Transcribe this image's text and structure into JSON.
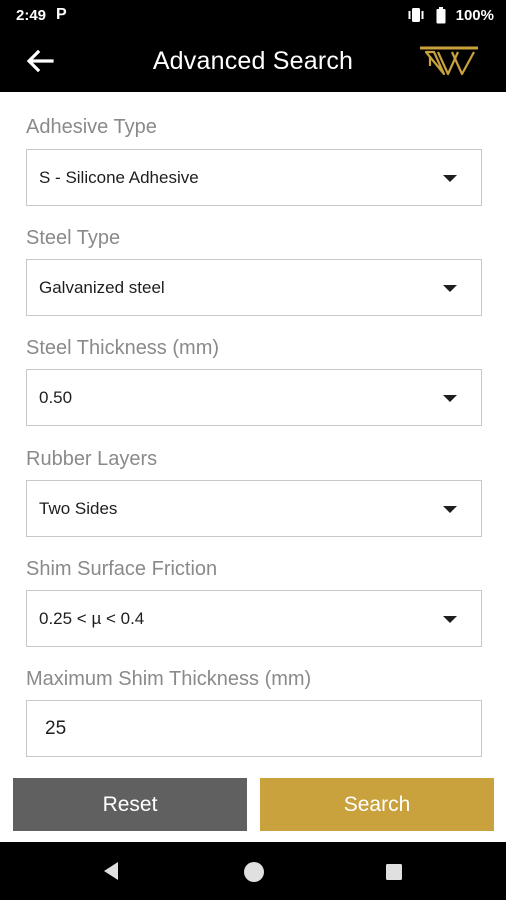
{
  "status_bar": {
    "time": "2:49",
    "notification_icon": "P",
    "battery": "100%",
    "icons": [
      "vibrate-icon",
      "battery-icon"
    ]
  },
  "app_bar": {
    "title": "Advanced Search",
    "back_icon": "arrow-left-icon",
    "logo": "brand-logo"
  },
  "form": {
    "adhesive_type": {
      "label": "Adhesive Type",
      "value": "S - Silicone Adhesive"
    },
    "steel_type": {
      "label": "Steel Type",
      "value": "Galvanized steel"
    },
    "steel_thickness": {
      "label": "Steel Thickness (mm)",
      "value": "0.50"
    },
    "rubber_layers": {
      "label": "Rubber Layers",
      "value": "Two Sides"
    },
    "shim_friction": {
      "label": "Shim Surface Friction",
      "value": "0.25 < µ < 0.4"
    },
    "max_shim_thickness": {
      "label": "Maximum Shim Thickness (mm)",
      "value": "25"
    }
  },
  "buttons": {
    "reset": "Reset",
    "search": "Search"
  },
  "colors": {
    "accent": "#c9a13d",
    "reset_button": "#606060",
    "bar_background": "#000000",
    "label": "#8a8a8a"
  },
  "nav_bar": {
    "icons": [
      "nav-back-icon",
      "nav-home-icon",
      "nav-recent-icon"
    ]
  }
}
